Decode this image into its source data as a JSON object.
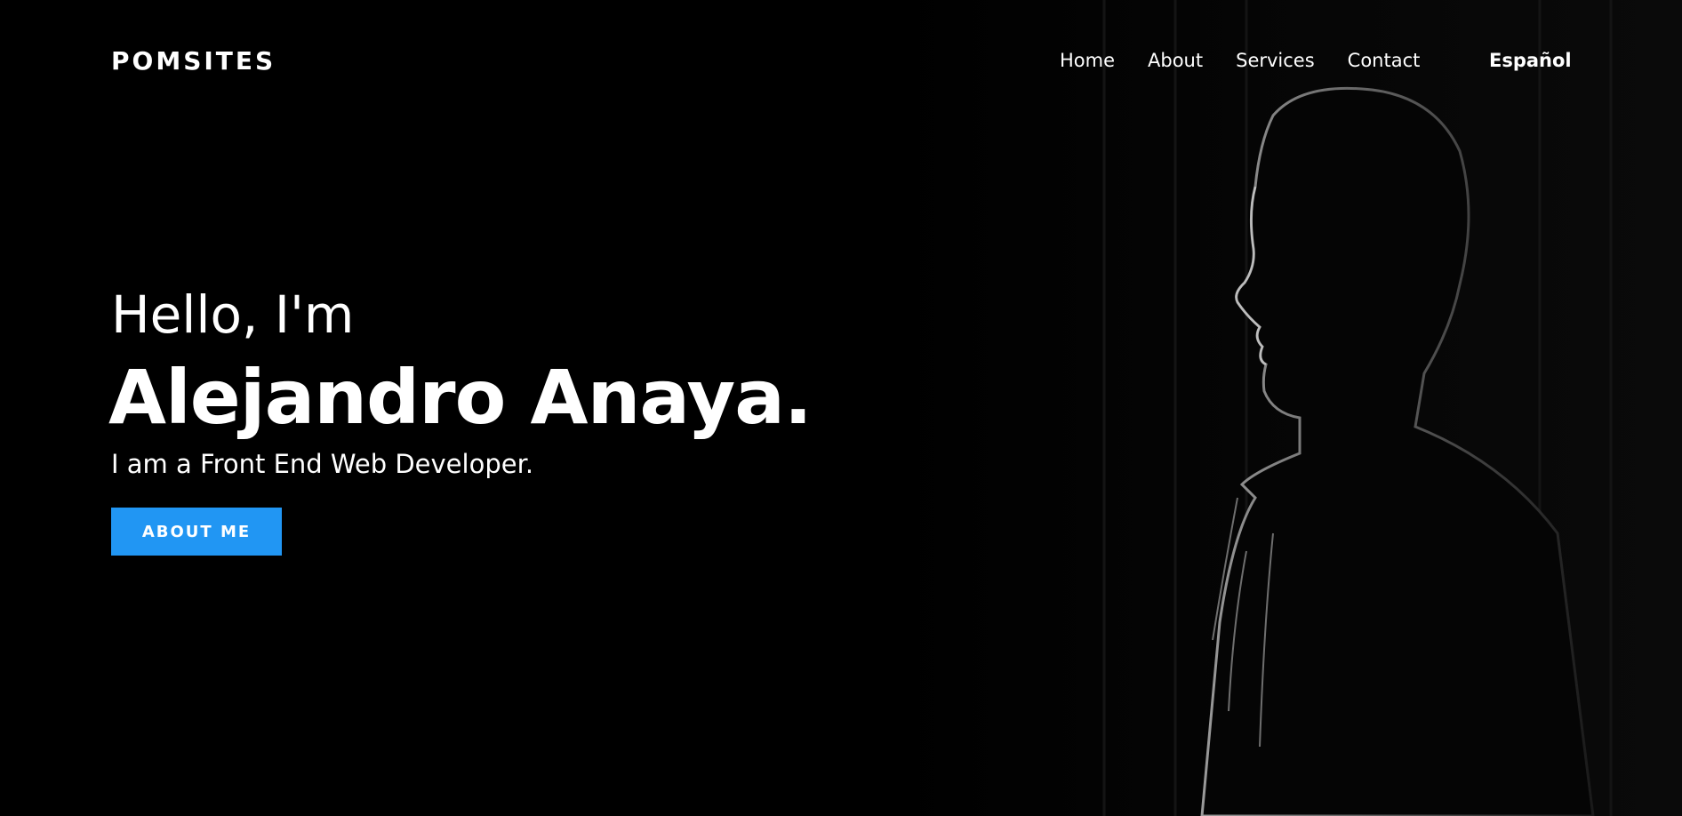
{
  "header": {
    "brand": "POMSITES",
    "nav": [
      {
        "label": "Home"
      },
      {
        "label": "About"
      },
      {
        "label": "Services"
      },
      {
        "label": "Contact"
      }
    ],
    "language_link": "Español"
  },
  "hero": {
    "greeting": "Hello, I'm",
    "name": "Alejandro Anaya.",
    "tagline": "I am a Front End Web Developer.",
    "cta_label": "ABOUT ME"
  },
  "colors": {
    "background": "#000000",
    "text": "#ffffff",
    "accent": "#2196f3"
  },
  "background_image": "dark-portrait-profile-silhouette"
}
